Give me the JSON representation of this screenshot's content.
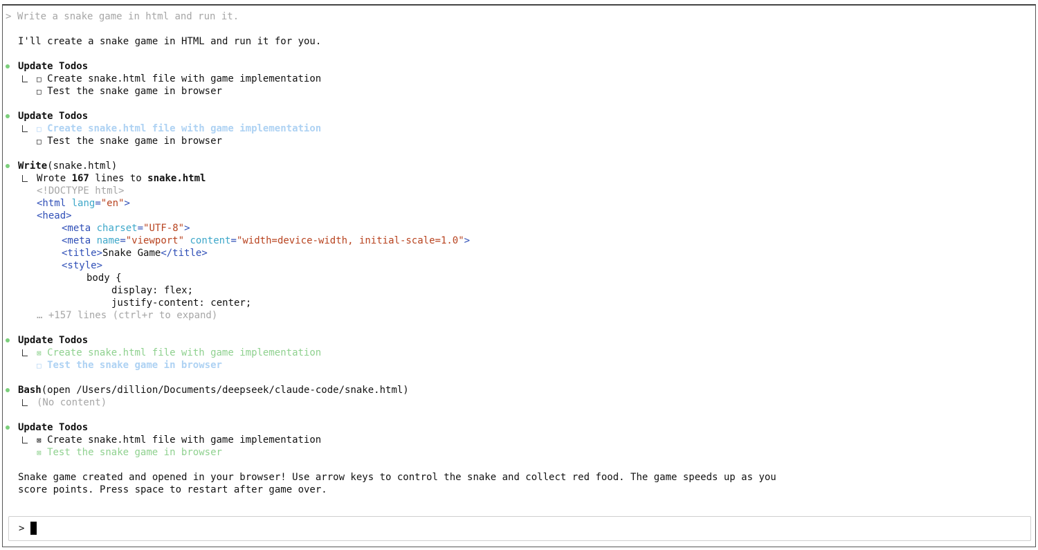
{
  "history": {
    "prompt_symbol": ">",
    "user_prompt": "Write a snake game in html and run it."
  },
  "assistant_intro": "I'll create a snake game in HTML and run it for you.",
  "todos_block_1": {
    "title": "Update Todos",
    "items": [
      "Create snake.html file with game implementation",
      "Test the snake game in browser"
    ]
  },
  "todos_block_2": {
    "title": "Update Todos",
    "items": [
      "Create snake.html file with game implementation",
      "Test the snake game in browser"
    ]
  },
  "write_block": {
    "tool": "Write",
    "arg": "(snake.html)",
    "wrote_prefix": "Wrote ",
    "wrote_count": "167",
    "wrote_middle": " lines to ",
    "wrote_file": "snake.html",
    "more": "… +157 lines (ctrl+r to expand)"
  },
  "todos_block_3": {
    "title": "Update Todos",
    "items": [
      "Create snake.html file with game implementation",
      "Test the snake game in browser"
    ]
  },
  "bash_block": {
    "tool": "Bash",
    "arg": "(open /Users/dillion/Documents/deepseek/claude-code/snake.html)",
    "result": "(No content)"
  },
  "todos_block_4": {
    "title": "Update Todos",
    "items": [
      "Create snake.html file with game implementation",
      "Test the snake game in browser"
    ]
  },
  "final_message": {
    "line1": "Snake game created and opened in your browser! Use arrow keys to control the snake and collect red food. The game speeds up as you",
    "line2": "score points. Press space to restart after game over."
  },
  "input": {
    "prompt_symbol": ">"
  },
  "glyphs": {
    "unchecked": "□",
    "checked": "⊠"
  },
  "colors": {
    "bullet": "#7ccf7c",
    "in_progress": "#aed2f3",
    "completed": "#8fd18f",
    "tag": "#2f4fb7",
    "attr": "#3da7c9",
    "string": "#b8431f"
  }
}
